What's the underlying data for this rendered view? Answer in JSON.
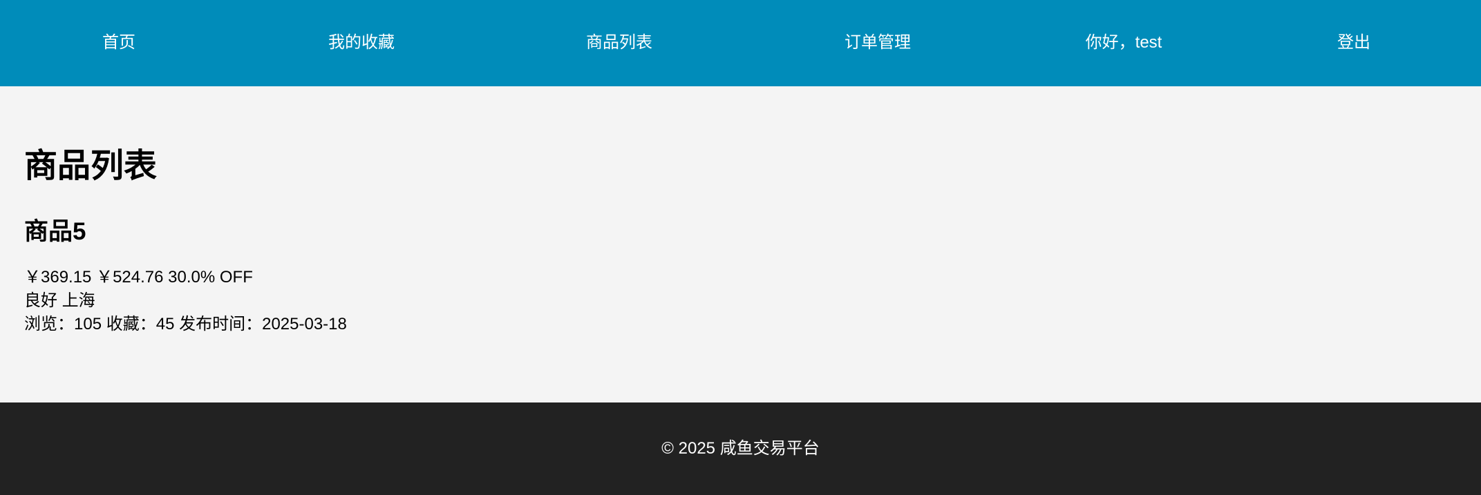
{
  "nav": {
    "home": "首页",
    "favorites": "我的收藏",
    "products": "商品列表",
    "orders": "订单管理",
    "greeting": "你好，test",
    "logout": "登出"
  },
  "main": {
    "title": "商品列表",
    "product": {
      "name": "商品5",
      "price": "￥369.15",
      "original_price": "￥524.76",
      "discount": "30.0% OFF",
      "condition": "良好",
      "location": "上海",
      "views_label": "浏览：",
      "views": "105",
      "favorites_label": "收藏：",
      "favorites": "45",
      "published_label": "发布时间：",
      "published": "2025-03-18"
    }
  },
  "footer": {
    "copyright": "© 2025 咸鱼交易平台"
  },
  "colors": {
    "nav_bg": "#008cba",
    "page_bg": "#f4f4f4",
    "footer_bg": "#222222",
    "nav_text": "#ffffff"
  }
}
